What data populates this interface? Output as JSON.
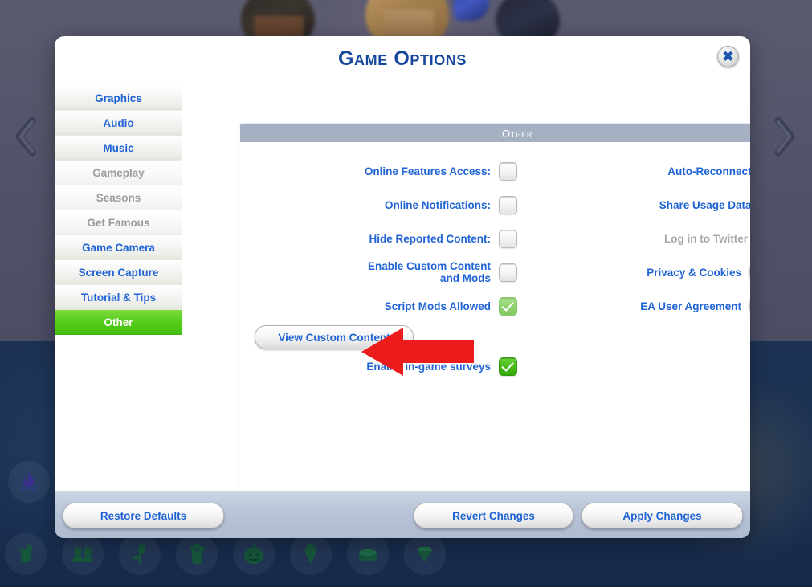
{
  "dialog": {
    "title": "Game Options",
    "close_icon": "close-icon"
  },
  "sidebar": {
    "items": [
      {
        "label": "Graphics",
        "state": "normal"
      },
      {
        "label": "Audio",
        "state": "normal"
      },
      {
        "label": "Music",
        "state": "normal"
      },
      {
        "label": "Gameplay",
        "state": "disabled"
      },
      {
        "label": "Seasons",
        "state": "disabled"
      },
      {
        "label": "Get Famous",
        "state": "disabled"
      },
      {
        "label": "Game Camera",
        "state": "normal"
      },
      {
        "label": "Screen Capture",
        "state": "normal"
      },
      {
        "label": "Tutorial & Tips",
        "state": "normal"
      },
      {
        "label": "Other",
        "state": "active"
      }
    ]
  },
  "content": {
    "section_header": "Other",
    "left_column": [
      {
        "label": "Online Features Access:",
        "control": "checkbox",
        "checked": false,
        "disabled": false
      },
      {
        "label": "Online Notifications:",
        "control": "checkbox",
        "checked": false,
        "disabled": false
      },
      {
        "label": "Hide Reported Content:",
        "control": "checkbox",
        "checked": false,
        "disabled": false
      },
      {
        "label": "Enable Custom Content and Mods",
        "control": "checkbox",
        "checked": false,
        "disabled": false
      },
      {
        "label": "Script Mods Allowed",
        "control": "checkbox",
        "checked": true,
        "disabled": true
      },
      {
        "label": "View Custom Content",
        "control": "button",
        "checked": false,
        "disabled": false
      },
      {
        "label": "Enable in-game surveys",
        "control": "checkbox",
        "checked": true,
        "disabled": false
      }
    ],
    "right_column": [
      {
        "label": "Auto-Reconnect:",
        "control": "checkbox",
        "checked": true,
        "disabled": false,
        "icon": ""
      },
      {
        "label": "Share Usage Data:",
        "control": "checkbox",
        "checked": false,
        "disabled": false,
        "icon": ""
      },
      {
        "label": "Log in to Twitter",
        "control": "icon-button",
        "checked": false,
        "disabled": true,
        "icon": "twitter-icon"
      },
      {
        "label": "Privacy & Cookies",
        "control": "icon-button",
        "checked": false,
        "disabled": false,
        "icon": "shield-check-icon"
      },
      {
        "label": "EA User Agreement",
        "control": "icon-button",
        "checked": false,
        "disabled": false,
        "icon": "document-icon"
      }
    ]
  },
  "footer": {
    "restore_label": "Restore Defaults",
    "revert_label": "Revert Changes",
    "apply_label": "Apply Changes"
  },
  "background": {
    "prev_icon": "chevron-left-icon",
    "next_icon": "chevron-right-icon",
    "campfire_icon": "campfire-icon",
    "pack_icons": [
      "drink-icon",
      "friends-icon",
      "rose-icon",
      "popcorn-icon",
      "pumpkin-icon",
      "ice-cream-icon",
      "cake-icon",
      "diamond-icon"
    ]
  },
  "annotation": {
    "arrow_icon": "red-arrow-left-icon",
    "arrow_color": "#ec1c1c"
  },
  "colors": {
    "accent_blue": "#1f63d4",
    "title_blue": "#15479b",
    "active_green": "#53cb19",
    "section_gray": "#a5b0c2",
    "footer_blue_gray": "#b9c6d8"
  }
}
